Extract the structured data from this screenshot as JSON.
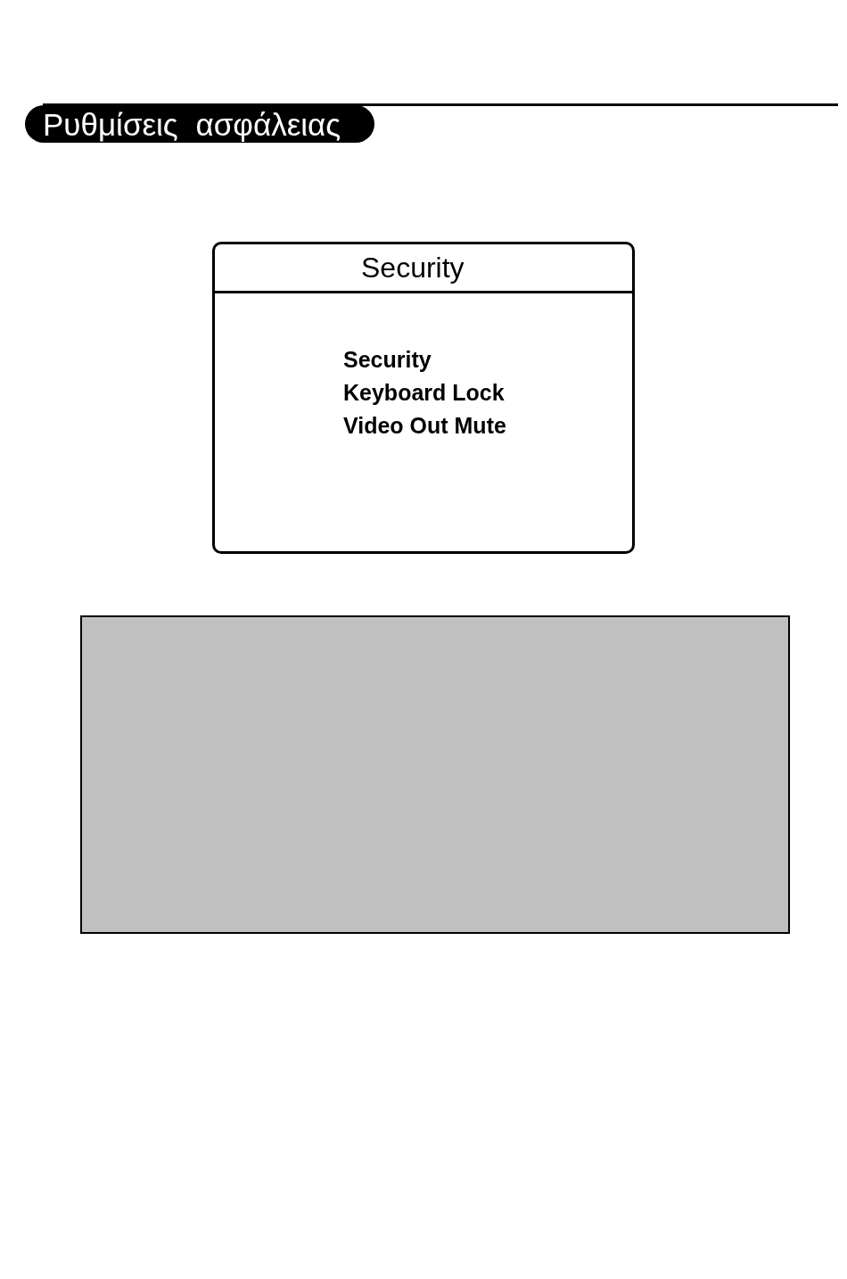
{
  "section_title": "Ρυθμίσεις ασφάλειας",
  "menu": {
    "title": "Security",
    "items": [
      {
        "label": "Security"
      },
      {
        "label": "Keyboard Lock"
      },
      {
        "label": "Video Out Mute"
      }
    ]
  }
}
